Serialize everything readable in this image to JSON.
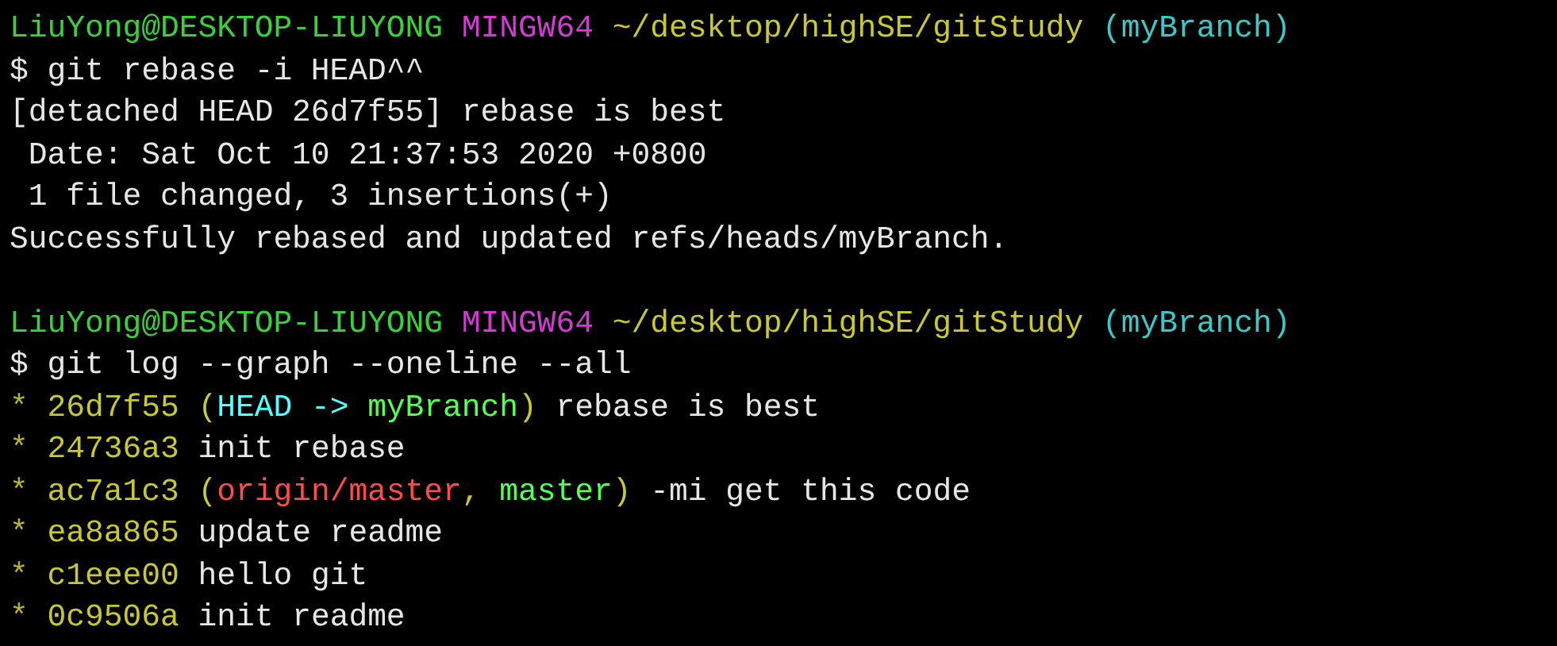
{
  "blocks": [
    {
      "lines": [
        [
          {
            "kind": "user",
            "text": "LiuYong@DESKTOP-LIUYONG "
          },
          {
            "kind": "system",
            "text": "MINGW64 "
          },
          {
            "kind": "path",
            "text": "~/desktop/highSE/gitStudy "
          },
          {
            "kind": "branch",
            "text": "(myBranch)"
          }
        ],
        [
          {
            "kind": "text",
            "text": "$ git rebase -i HEAD^^"
          }
        ],
        [
          {
            "kind": "text",
            "text": "[detached HEAD 26d7f55] rebase is best"
          }
        ],
        [
          {
            "kind": "text",
            "text": " Date: Sat Oct 10 21:37:53 2020 +0800"
          }
        ],
        [
          {
            "kind": "text",
            "text": " 1 file changed, 3 insertions(+)"
          }
        ],
        [
          {
            "kind": "text",
            "text": "Successfully rebased and updated refs/heads/myBranch."
          }
        ]
      ]
    },
    {
      "lines": [
        [
          {
            "kind": "user",
            "text": "LiuYong@DESKTOP-LIUYONG "
          },
          {
            "kind": "system",
            "text": "MINGW64 "
          },
          {
            "kind": "path",
            "text": "~/desktop/highSE/gitStudy "
          },
          {
            "kind": "branch",
            "text": "(myBranch)"
          }
        ],
        [
          {
            "kind": "text",
            "text": "$ git log --graph --oneline --all"
          }
        ],
        [
          {
            "kind": "graph",
            "text": "* "
          },
          {
            "kind": "hash",
            "text": "26d7f55 ("
          },
          {
            "kind": "head",
            "text": "HEAD -> "
          },
          {
            "kind": "local",
            "text": "myBranch"
          },
          {
            "kind": "hash",
            "text": ")"
          },
          {
            "kind": "text",
            "text": " rebase is best"
          }
        ],
        [
          {
            "kind": "graph",
            "text": "* "
          },
          {
            "kind": "hash",
            "text": "24736a3"
          },
          {
            "kind": "text",
            "text": " init rebase"
          }
        ],
        [
          {
            "kind": "graph",
            "text": "* "
          },
          {
            "kind": "hash",
            "text": "ac7a1c3 ("
          },
          {
            "kind": "remote",
            "text": "origin/master"
          },
          {
            "kind": "hash",
            "text": ", "
          },
          {
            "kind": "local",
            "text": "master"
          },
          {
            "kind": "hash",
            "text": ")"
          },
          {
            "kind": "text",
            "text": " -mi get this code"
          }
        ],
        [
          {
            "kind": "graph",
            "text": "* "
          },
          {
            "kind": "hash",
            "text": "ea8a865"
          },
          {
            "kind": "text",
            "text": " update readme"
          }
        ],
        [
          {
            "kind": "graph",
            "text": "* "
          },
          {
            "kind": "hash",
            "text": "c1eee00"
          },
          {
            "kind": "text",
            "text": " hello git"
          }
        ],
        [
          {
            "kind": "graph",
            "text": "* "
          },
          {
            "kind": "hash",
            "text": "0c9506a"
          },
          {
            "kind": "text",
            "text": " init readme"
          }
        ]
      ]
    }
  ]
}
